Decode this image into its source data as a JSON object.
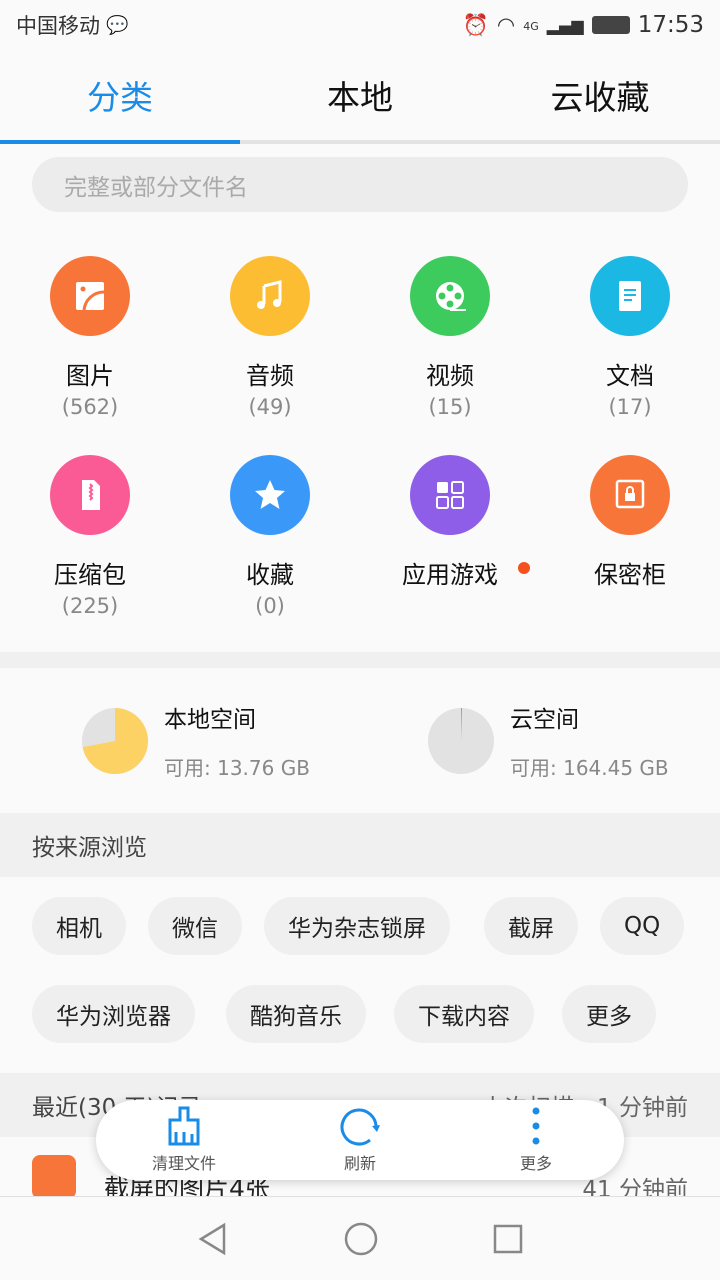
{
  "status_bar": {
    "carrier": "中国移动",
    "network": "4G",
    "time": "17:53",
    "icons": [
      "wechat-icon",
      "alarm-icon",
      "wifi-icon",
      "signal-icon",
      "battery-icon"
    ]
  },
  "tabs": [
    {
      "label": "分类",
      "active": true
    },
    {
      "label": "本地"
    },
    {
      "label": "云收藏"
    }
  ],
  "search": {
    "placeholder": "完整或部分文件名"
  },
  "categories": [
    {
      "label": "图片",
      "count": "(562)",
      "color": "#f8753a",
      "icon": "image-icon"
    },
    {
      "label": "音频",
      "count": "(49)",
      "color": "#fcbd33",
      "icon": "music-icon"
    },
    {
      "label": "视频",
      "count": "(15)",
      "color": "#3ecb5e",
      "icon": "video-reel-icon"
    },
    {
      "label": "文档",
      "count": "(17)",
      "color": "#1cb8e4",
      "icon": "document-icon"
    },
    {
      "label": "压缩包",
      "count": "(225)",
      "color": "#fa5b95",
      "icon": "zip-icon"
    },
    {
      "label": "收藏",
      "count": "(0)",
      "color": "#3a98f8",
      "icon": "star-icon"
    },
    {
      "label": "应用游戏",
      "count": "",
      "color": "#8f5ee8",
      "icon": "apps-icon",
      "badge": true
    },
    {
      "label": "保密柜",
      "count": "",
      "color": "#f8753a",
      "icon": "safe-icon"
    }
  ],
  "storage": {
    "local": {
      "title": "本地空间",
      "available": "可用: 13.76 GB",
      "used_fraction": 0.72
    },
    "cloud": {
      "title": "云空间",
      "available": "可用: 164.45 GB",
      "used_fraction": 0.005
    }
  },
  "browse": {
    "title": "按来源浏览",
    "sources": [
      "相机",
      "微信",
      "华为杂志锁屏",
      "截屏",
      "QQ",
      "华为浏览器",
      "酷狗音乐",
      "下载内容",
      "更多"
    ]
  },
  "recent": {
    "title": "最近(30 天)记录",
    "scan": "上次扫描：1 分钟前",
    "items": [
      {
        "title": "截屏的图片4张",
        "time": "41 分钟前"
      }
    ]
  },
  "float_bar": [
    {
      "label": "清理文件",
      "icon": "brush-icon"
    },
    {
      "label": "刷新",
      "icon": "refresh-icon"
    },
    {
      "label": "更多",
      "icon": "more-vertical-icon"
    }
  ],
  "colors": {
    "accent": "#1a8ce8",
    "pie_used": "#fdd265",
    "pie_free": "#e2e2e2"
  }
}
